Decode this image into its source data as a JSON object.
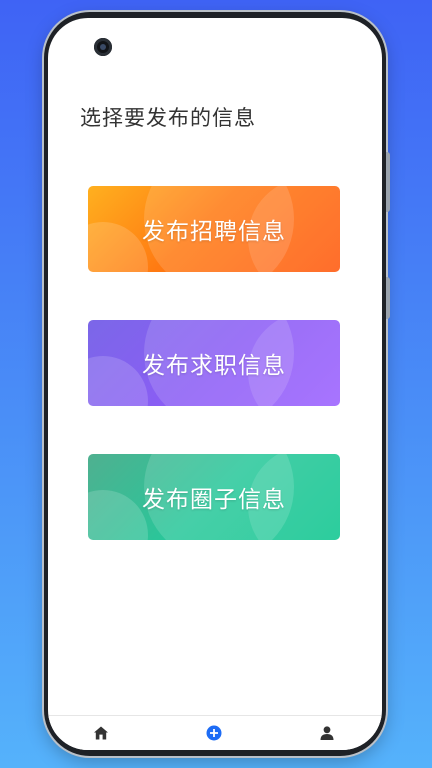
{
  "header": {
    "title": "选择要发布的信息"
  },
  "options": [
    {
      "label": "发布招聘信息"
    },
    {
      "label": "发布求职信息"
    },
    {
      "label": "发布圈子信息"
    }
  ],
  "colors": {
    "recruit": "#ff7a12",
    "jobseek": "#8c5cf6",
    "circle": "#1fc595",
    "tab_active": "#1d6cf5",
    "tab_inactive": "#333333"
  },
  "tabbar": {
    "icons": [
      "home-icon",
      "add-icon",
      "user-icon"
    ]
  }
}
